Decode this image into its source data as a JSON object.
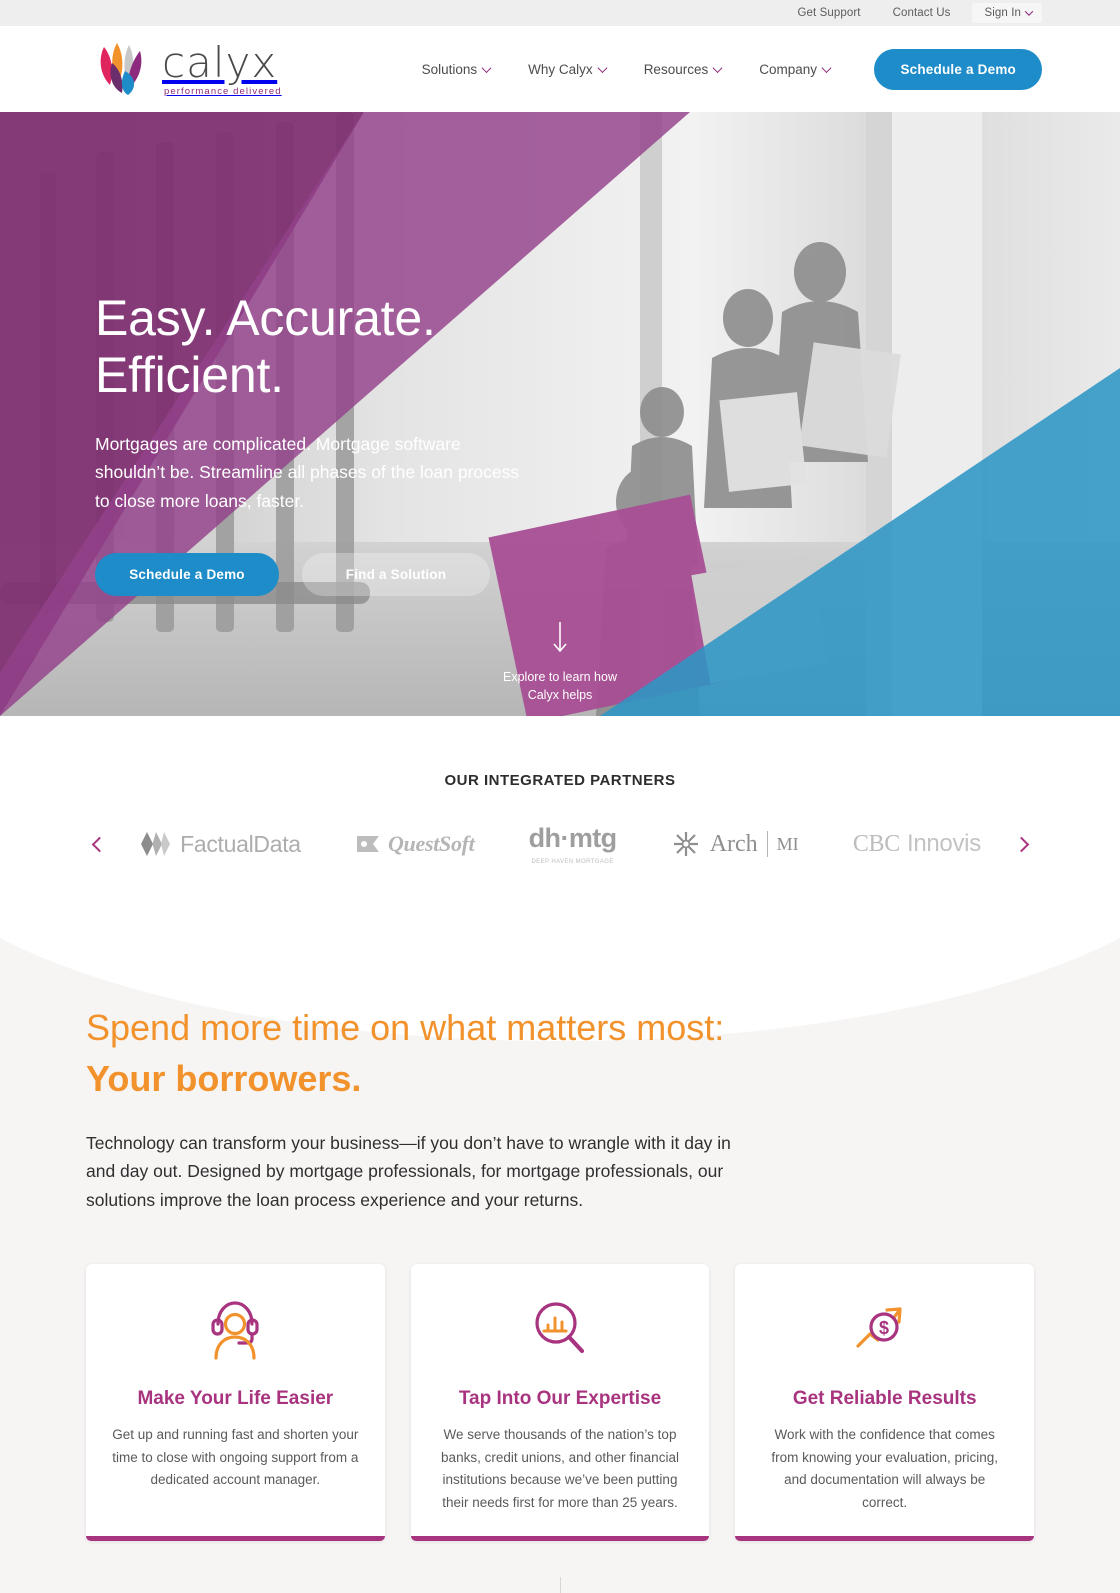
{
  "utility": {
    "links": [
      "Get Support",
      "Contact Us"
    ],
    "signin": "Sign In"
  },
  "brand": {
    "name": "calyx",
    "tagline": "performance delivered",
    "petal_colors": [
      "#e0245e",
      "#f2922c",
      "#bdbdbd",
      "#8e2a7e",
      "#6b2d6b",
      "#1d8cc9"
    ]
  },
  "nav": {
    "items": [
      "Solutions",
      "Why Calyx",
      "Resources",
      "Company"
    ],
    "cta": "Schedule a Demo"
  },
  "hero": {
    "headline_line1": "Easy. Accurate.",
    "headline_line2": "Efficient.",
    "paragraph": "Mortgages are complicated. Mortgage software shouldn’t be. Streamline all phases of the loan process to close more loans, faster.",
    "primary_cta": "Schedule a Demo",
    "secondary_cta": "Find a Solution",
    "explore_line1": "Explore to learn how",
    "explore_line2": "Calyx helps",
    "purple": "#8e3a80",
    "blue": "#2e96c4"
  },
  "partners": {
    "title": "OUR INTEGRATED PARTNERS",
    "items": [
      {
        "name": "FactualData",
        "id": "factualdata"
      },
      {
        "name": "QuestSoft",
        "id": "questsoft"
      },
      {
        "name": "dh·mtg",
        "id": "dhmtg",
        "sub": "DEEP HAVEN MORTGAGE"
      },
      {
        "name": "Arch MI",
        "id": "archmi",
        "word": "Arch",
        "abbr": "MI"
      },
      {
        "name": "CBC Innovis",
        "id": "cbcinnovis",
        "part1": "CBC",
        "part2": "Innovis"
      }
    ],
    "prev_label": "Previous partners",
    "next_label": "Next partners"
  },
  "matters": {
    "heading_line1": "Spend more time on what matters most:",
    "heading_line2": "Your borrowers.",
    "paragraph": "Technology can transform your business—if you don’t have to wrangle with it day in and day out. Designed by mortgage professionals, for mortgage professionals, our solutions improve the loan process experience and your returns.",
    "accent": "#f2922c"
  },
  "cards": [
    {
      "icon": "support-agent-icon",
      "title": "Make Your Life Easier",
      "body": "Get up and running fast and shorten your time to close with ongoing support from a dedicated account manager."
    },
    {
      "icon": "magnifier-chart-icon",
      "title": "Tap Into Our Expertise",
      "body": "We serve thousands of the nation’s top banks, credit unions, and other financial institutions because we’ve been putting their needs first for more than 25 years."
    },
    {
      "icon": "dollar-growth-icon",
      "title": "Get Reliable Results",
      "body": "Work with the confidence that comes from knowing your evaluation, pricing, and documentation will always be correct."
    }
  ],
  "colors": {
    "purple": "#a8337f",
    "orange": "#f2922c",
    "blue": "#1d8cc9",
    "gray_bg": "#f7f5f4"
  }
}
